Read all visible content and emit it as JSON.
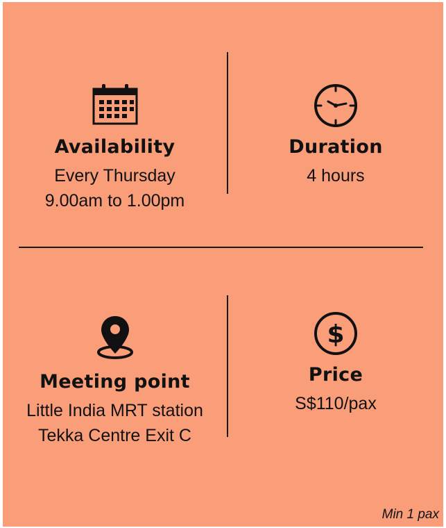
{
  "availability": {
    "icon": "calendar-icon",
    "title": "Availability",
    "line1": "Every Thursday",
    "line2": "9.00am to 1.00pm"
  },
  "duration": {
    "icon": "clock-icon",
    "title": "Duration",
    "line1": "4 hours"
  },
  "meeting_point": {
    "icon": "map-pin-icon",
    "title": "Meeting point",
    "line1": "Little India MRT station",
    "line2": "Tekka Centre Exit C"
  },
  "price": {
    "icon": "dollar-circle-icon",
    "title": "Price",
    "line1": "S$110/pax"
  },
  "footnote": "Min 1 pax",
  "colors": {
    "background": "#fa9e7a",
    "text": "#111111"
  }
}
